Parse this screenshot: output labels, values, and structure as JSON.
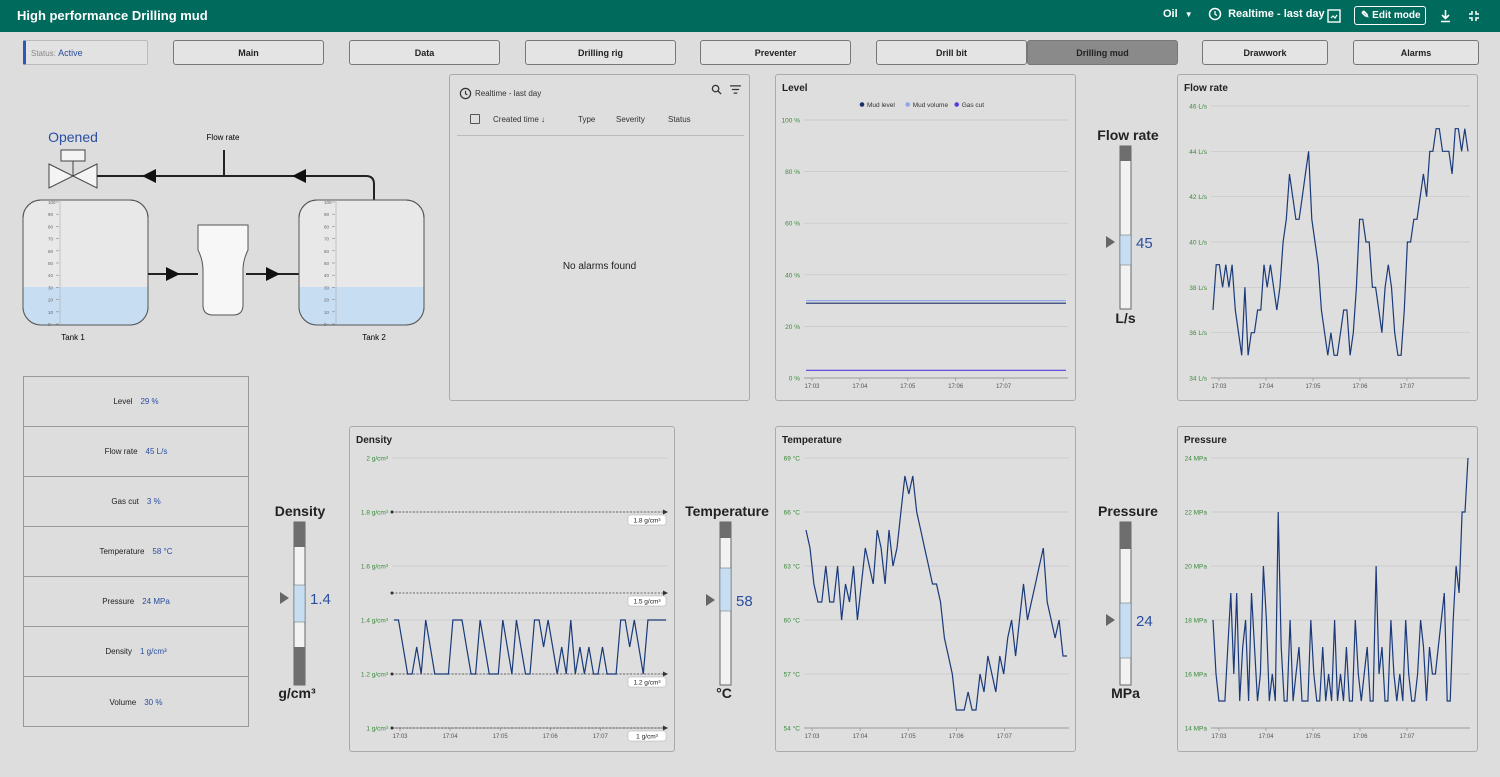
{
  "app": {
    "title": "High performance Drilling mud"
  },
  "toolbar": {
    "site": "Oil",
    "time_range": "Realtime - last day",
    "edit_label": "Edit mode"
  },
  "status": {
    "label": "Status:",
    "value": "Active"
  },
  "nav": [
    "Main",
    "Data",
    "Drilling rig",
    "Preventer",
    "Drill bit",
    "Drilling mud",
    "Drawwork",
    "Alarms"
  ],
  "diagram": {
    "valve_state": "Opened",
    "flow_label": "Flow rate",
    "tank1": "Tank 1",
    "tank2": "Tank 2",
    "tank1_level": 29,
    "tank2_level": 30,
    "scale": [
      "100",
      "90",
      "80",
      "70",
      "60",
      "50",
      "40",
      "30",
      "20",
      "10",
      "0"
    ]
  },
  "alarms": {
    "time_range": "Realtime - last day",
    "columns": [
      "Created time",
      "Type",
      "Severity",
      "Status"
    ],
    "empty": "No alarms found"
  },
  "params": [
    {
      "label": "Level",
      "value": "29 %"
    },
    {
      "label": "Flow rate",
      "value": "45 L/s"
    },
    {
      "label": "Gas cut",
      "value": "3 %"
    },
    {
      "label": "Temperature",
      "value": "58 °C"
    },
    {
      "label": "Pressure",
      "value": "24 MPa"
    },
    {
      "label": "Density",
      "value": "1 g/cm³"
    },
    {
      "label": "Volume",
      "value": "30 %"
    }
  ],
  "gauges": {
    "flow": {
      "title": "Flow rate",
      "value": "45",
      "unit": "L/s"
    },
    "density": {
      "title": "Density",
      "value": "1.4",
      "unit": "g/cm³"
    },
    "temperature": {
      "title": "Temperature",
      "value": "58",
      "unit": "°C"
    },
    "pressure": {
      "title": "Pressure",
      "value": "24",
      "unit": "MPa"
    }
  },
  "colors": {
    "accent": "#006b5c",
    "series": "#1a3a7a",
    "tick": "#3a8a3a",
    "fill": "#c7ddf2"
  },
  "chart_data": [
    {
      "id": "level",
      "type": "line",
      "title": "Level",
      "x": [
        "17:03",
        "17:04",
        "17:05",
        "17:06",
        "17:07"
      ],
      "ylim": [
        0,
        100
      ],
      "yticks": [
        "0 %",
        "20 %",
        "40 %",
        "60 %",
        "80 %",
        "100 %"
      ],
      "series": [
        {
          "name": "Mud level",
          "color": "#1a2f6a",
          "values": [
            29,
            29,
            29,
            29,
            29
          ]
        },
        {
          "name": "Mud volume",
          "color": "#8fa8e8",
          "values": [
            30,
            30,
            30,
            30,
            30
          ]
        },
        {
          "name": "Gas cut",
          "color": "#5a3ae0",
          "values": [
            3,
            3,
            3,
            3,
            3
          ]
        }
      ]
    },
    {
      "id": "flow",
      "type": "line",
      "title": "Flow rate",
      "x": [
        "17:03",
        "17:04",
        "17:05",
        "17:06",
        "17:07"
      ],
      "ylim": [
        34,
        46
      ],
      "yticks": [
        "34 L/s",
        "36 L/s",
        "38 L/s",
        "40 L/s",
        "42 L/s",
        "44 L/s",
        "46 L/s"
      ],
      "series": [
        {
          "name": "",
          "values": [
            37,
            39,
            39,
            38,
            39,
            38,
            39,
            37,
            36,
            35,
            38,
            35,
            36,
            36,
            37,
            37,
            39,
            38,
            39,
            38,
            37,
            38,
            40,
            41,
            43,
            42,
            41,
            41,
            42,
            43,
            44,
            41,
            40,
            39,
            37,
            36,
            35,
            36,
            35,
            35,
            36,
            37,
            37,
            35,
            36,
            38,
            41,
            41,
            40,
            40,
            38,
            38,
            37,
            36,
            38,
            39,
            38,
            36,
            35,
            35,
            37,
            40,
            40,
            41,
            41,
            42,
            43,
            42,
            44,
            44,
            45,
            45,
            44,
            44,
            44,
            43,
            45,
            45,
            44,
            45,
            44
          ]
        }
      ]
    },
    {
      "id": "density",
      "type": "line",
      "title": "Density",
      "x": [
        "17:03",
        "17:04",
        "17:05",
        "17:06",
        "17:07"
      ],
      "ylim": [
        1,
        2
      ],
      "yticks": [
        "1 g/cm³",
        "1.2 g/cm³",
        "1.4 g/cm³",
        "1.6 g/cm³",
        "1.8 g/cm³",
        "2 g/cm³"
      ],
      "thresholds": [
        {
          "value": 1.8,
          "label": "1.8 g/cm³"
        },
        {
          "value": 1.5,
          "label": "1.5 g/cm³"
        },
        {
          "value": 1.2,
          "label": "1.2 g/cm³"
        },
        {
          "value": 1.0,
          "label": "1 g/cm³"
        }
      ],
      "series": [
        {
          "name": "",
          "values": [
            1.4,
            1.4,
            1.3,
            1.2,
            1.2,
            1.3,
            1.2,
            1.4,
            1.3,
            1.2,
            1.2,
            1.2,
            1.2,
            1.4,
            1.4,
            1.4,
            1.3,
            1.2,
            1.2,
            1.4,
            1.3,
            1.2,
            1.2,
            1.2,
            1.4,
            1.3,
            1.2,
            1.4,
            1.3,
            1.2,
            1.2,
            1.4,
            1.4,
            1.3,
            1.4,
            1.3,
            1.2,
            1.3,
            1.2,
            1.4,
            1.2,
            1.3,
            1.2,
            1.3,
            1.2,
            1.2,
            1.3,
            1.2,
            1.2,
            1.2,
            1.4,
            1.4,
            1.3,
            1.4,
            1.3,
            1.2,
            1.4,
            1.4,
            1.4,
            1.4,
            1.4
          ]
        }
      ]
    },
    {
      "id": "temperature",
      "type": "line",
      "title": "Temperature",
      "x": [
        "17:03",
        "17:04",
        "17:05",
        "17:06",
        "17:07"
      ],
      "ylim": [
        54,
        69
      ],
      "yticks": [
        "54 °C",
        "57 °C",
        "60 °C",
        "63 °C",
        "66 °C",
        "69 °C"
      ],
      "series": [
        {
          "name": "",
          "values": [
            65,
            64,
            62,
            61,
            61,
            63,
            61,
            61,
            63,
            60,
            62,
            61,
            63,
            60,
            62,
            64,
            63,
            62,
            65,
            64,
            62,
            65,
            63,
            64,
            66,
            68,
            67,
            68,
            66,
            65,
            64,
            63,
            62,
            62,
            61,
            59,
            58,
            57,
            55,
            55,
            55,
            56,
            55,
            55,
            57,
            56,
            58,
            57,
            56,
            58,
            57,
            59,
            60,
            58,
            60,
            62,
            60,
            61,
            62,
            63,
            64,
            61,
            60,
            59,
            60,
            58,
            58
          ]
        }
      ]
    },
    {
      "id": "pressure",
      "type": "line",
      "title": "Pressure",
      "x": [
        "17:03",
        "17:04",
        "17:05",
        "17:06",
        "17:07"
      ],
      "ylim": [
        14,
        24
      ],
      "yticks": [
        "14 MPa",
        "16 MPa",
        "18 MPa",
        "20 MPa",
        "22 MPa",
        "24 MPa"
      ],
      "series": [
        {
          "name": "",
          "values": [
            18,
            16,
            15,
            15,
            15,
            17,
            19,
            16,
            19,
            15,
            17,
            18,
            15,
            19,
            17,
            15,
            16,
            20,
            18,
            15,
            16,
            15,
            22,
            17,
            15,
            15,
            18,
            15,
            16,
            17,
            15,
            15,
            15,
            18,
            16,
            15,
            15,
            17,
            15,
            16,
            15,
            18,
            15,
            16,
            15,
            17,
            15,
            15,
            18,
            16,
            15,
            16,
            17,
            15,
            15,
            20,
            16,
            17,
            15,
            15,
            18,
            16,
            15,
            16,
            15,
            18,
            16,
            15,
            15,
            16,
            18,
            17,
            15,
            17,
            16,
            16,
            17,
            18,
            19,
            15,
            15,
            18,
            20,
            19,
            22,
            22,
            24
          ]
        }
      ]
    }
  ]
}
